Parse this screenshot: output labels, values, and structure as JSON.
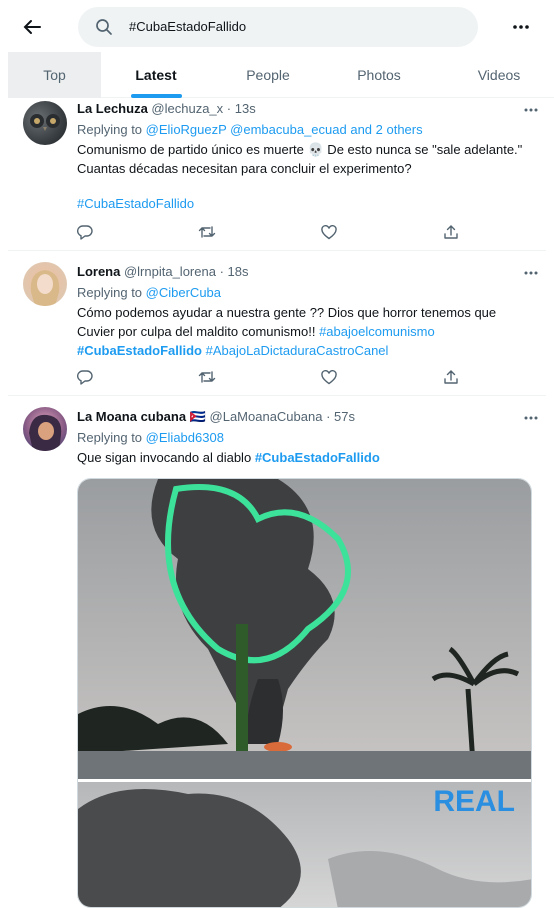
{
  "search": {
    "query": "#CubaEstadoFallido"
  },
  "tabs": [
    "Top",
    "Latest",
    "People",
    "Photos",
    "Videos"
  ],
  "tweets": [
    {
      "name": "La Lechuza",
      "handle": "@lechuza_x",
      "time": "· 13s",
      "replying_prefix": "Replying to",
      "replying_to": "@ElioRguezP @embacuba_ecuad and 2 others",
      "text1": "Comunismo de partido único es muerte 💀 De esto nunca se \"sale adelante.\" Cuantas décadas  necesitan para concluir el experimento?",
      "hashtag": "#CubaEstadoFallido"
    },
    {
      "name": "Lorena",
      "handle": "@lrnpita_lorena",
      "time": "· 18s",
      "replying_prefix": "Replying to",
      "replying_to": "@CiberCuba",
      "text1": "Cómo podemos ayudar a nuestra gente ?? Dios que horror tenemos que Cuvier por culpa del maldito comunismo!!",
      "hashtag1": "#abajoelcomunismo",
      "hashtag2": "#CubaEstadoFallido",
      "hashtag3": "#AbajoLaDictaduraCastroCanel"
    },
    {
      "name": "La Moana cubana",
      "flag": "🇨🇺",
      "handle": "@LaMoanaCubana",
      "time": "· 57s",
      "replying_prefix": "Replying to",
      "replying_to": "@Eliabd6308",
      "text1": "Que sigan invocando al diablo",
      "hashtag": "#CubaEstadoFallido",
      "media_label": "REAL"
    }
  ],
  "icons": {
    "back": "arrow-left-icon",
    "search": "search-icon",
    "more": "more-horizontal-icon",
    "reply": "reply-icon",
    "retweet": "retweet-icon",
    "like": "heart-icon",
    "share": "share-icon"
  },
  "colors": {
    "accent": "#1d9bf0",
    "secondary_text": "#536471"
  }
}
